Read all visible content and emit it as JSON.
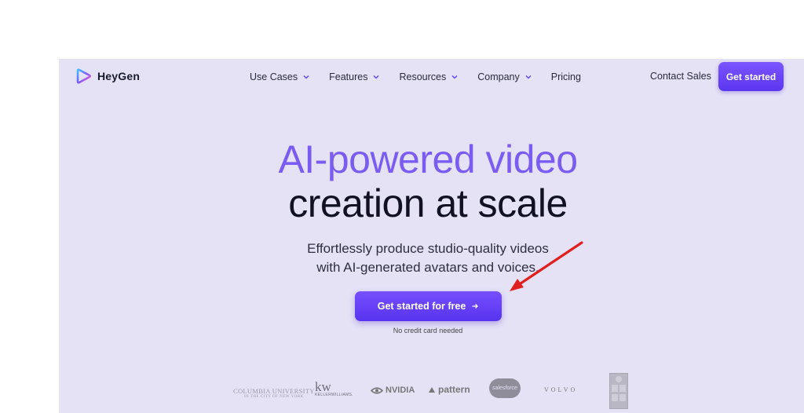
{
  "brand": {
    "name": "HeyGen",
    "accent": "#6c47ff"
  },
  "nav": [
    {
      "label": "Use Cases",
      "dropdown": true
    },
    {
      "label": "Features",
      "dropdown": true
    },
    {
      "label": "Resources",
      "dropdown": true
    },
    {
      "label": "Company",
      "dropdown": true
    },
    {
      "label": "Pricing",
      "dropdown": false
    }
  ],
  "header": {
    "contact_label": "Contact Sales",
    "cta_label": "Get started"
  },
  "hero": {
    "title_line1": "AI-powered video",
    "title_line2": "creation at scale",
    "subtitle_line1": "Effortlessly produce studio-quality videos",
    "subtitle_line2": "with AI-generated avatars and voices.",
    "cta_label": "Get started for free",
    "note": "No credit card needed"
  },
  "logos": {
    "columbia": "COLUMBIA UNIVERSITY",
    "columbia_sub": "IN THE CITY OF NEW YORK",
    "kw": "kw",
    "kw_sub": "KELLERWILLIAMS.",
    "nvidia": "NVIDIA",
    "pattern": "pattern",
    "salesforce": "salesforce",
    "volvo": "VOLVO"
  }
}
